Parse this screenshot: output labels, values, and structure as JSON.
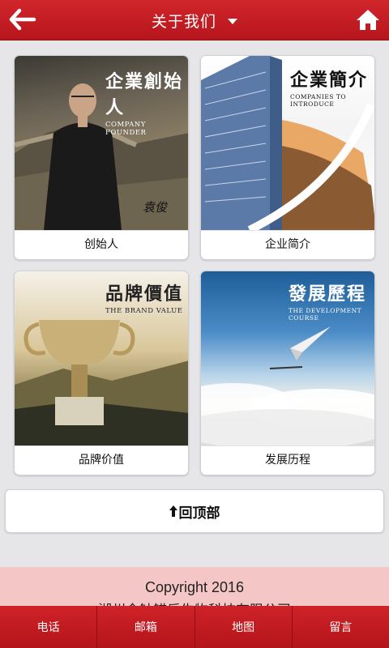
{
  "header": {
    "title": "关于我们",
    "back_icon": "back-arrow-icon",
    "home_icon": "home-icon",
    "bar_color": "#c41e24"
  },
  "cards": [
    {
      "label": "创始人",
      "caption_cn": "企業創始人",
      "caption_en": "COMPANY FOUNDER",
      "signature": "袁俊"
    },
    {
      "label": "企业简介",
      "caption_cn": "企業簡介",
      "caption_en": "COMPANIES TO INTRODUCE"
    },
    {
      "label": "品牌价值",
      "caption_cn": "品牌價值",
      "caption_en": "THE BRAND VALUE"
    },
    {
      "label": "发展历程",
      "caption_cn": "發展歷程",
      "caption_en": "THE DEVELOPMENT COURSE"
    }
  ],
  "back_to_top": {
    "label": "回顶部"
  },
  "footer": {
    "copyright": "Copyright 2016",
    "company": "湖州金钟锚乐生物科技有限公司"
  },
  "bottom_nav": [
    {
      "label": "电话"
    },
    {
      "label": "邮箱"
    },
    {
      "label": "地图"
    },
    {
      "label": "留言"
    }
  ]
}
